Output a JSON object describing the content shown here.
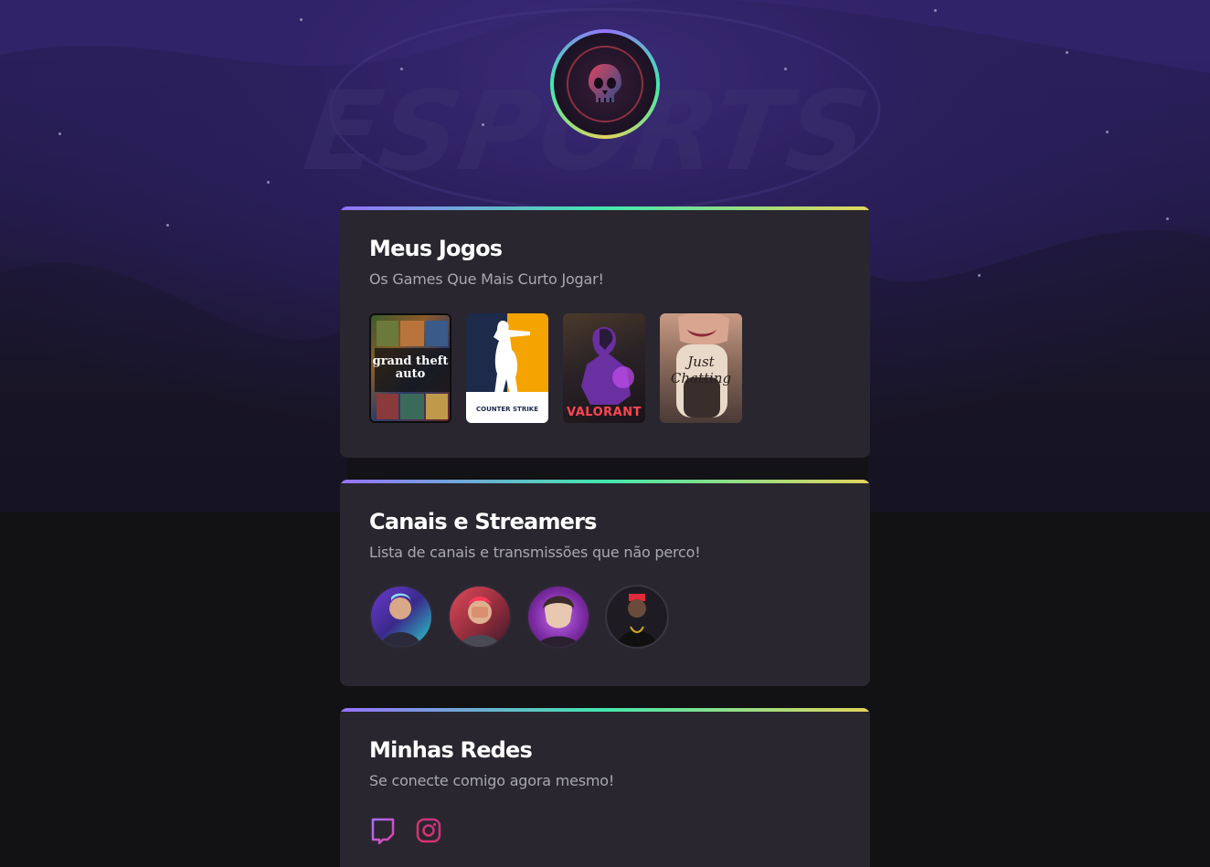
{
  "profile": {
    "avatar_icon": "skull-icon"
  },
  "background": {
    "watermark_text": "ESPORTS",
    "colors": {
      "top": "#2d2160",
      "bottom": "#121214"
    }
  },
  "accent_gradient": [
    "#9572fc",
    "#43e7ad",
    "#e2d45c"
  ],
  "sections": {
    "games": {
      "title": "Meus Jogos",
      "subtitle": "Os Games Que Mais Curto Jogar!",
      "items": [
        {
          "name": "grand theft auto",
          "icon": "gta-v-cover"
        },
        {
          "name": "COUNTER STRIKE",
          "icon": "counter-strike-cover"
        },
        {
          "name": "VALORANT",
          "icon": "valorant-cover"
        },
        {
          "name": "Just Chatting",
          "icon": "just-chatting-cover"
        }
      ]
    },
    "streamers": {
      "title": "Canais e Streamers",
      "subtitle": "Lista de canais e transmissões que não perco!",
      "items": [
        {
          "icon": "streamer-1-avatar"
        },
        {
          "icon": "streamer-2-avatar"
        },
        {
          "icon": "streamer-3-avatar"
        },
        {
          "icon": "streamer-4-avatar"
        }
      ]
    },
    "socials": {
      "title": "Minhas Redes",
      "subtitle": "Se conecte comigo agora mesmo!",
      "items": [
        {
          "icon": "twitch-icon",
          "color": "#a970ff"
        },
        {
          "icon": "instagram-icon",
          "color": "#e1306c"
        }
      ]
    }
  }
}
